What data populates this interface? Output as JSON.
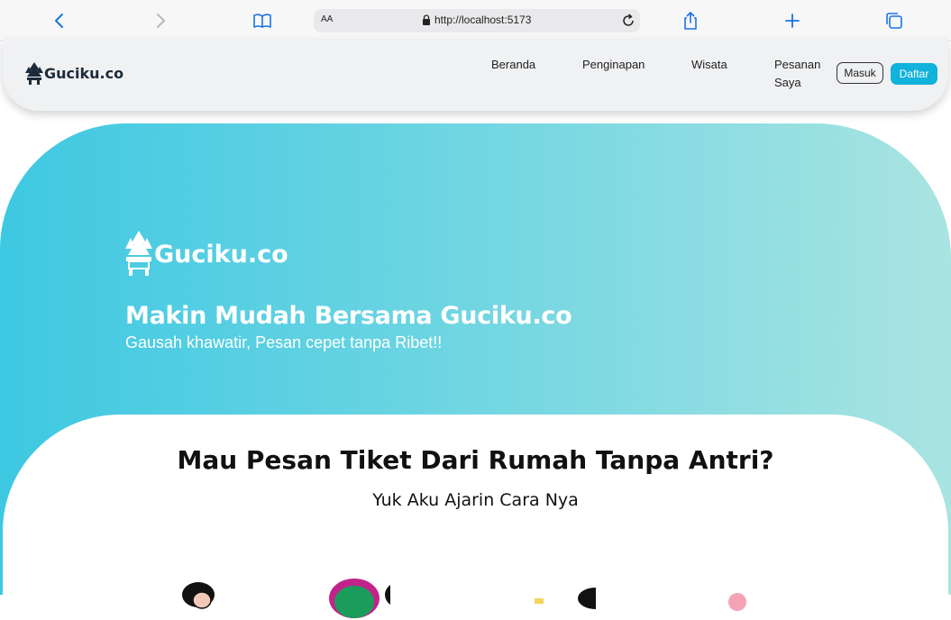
{
  "browser": {
    "text_size_label": "AA",
    "url": "http://localhost:5173"
  },
  "navbar": {
    "brand": "Guciku.co",
    "links": [
      "Beranda",
      "Penginapan",
      "Wisata",
      "Pesanan Saya"
    ],
    "login_label": "Masuk",
    "register_label": "Daftar"
  },
  "hero": {
    "brand": "Guciku.co",
    "title": "Makin Mudah Bersama Guciku.co",
    "subtitle": "Gausah khawatir, Pesan cepet tanpa Ribet!!"
  },
  "section": {
    "title": "Mau Pesan Tiket Dari Rumah Tanpa Antri?",
    "subtitle": "Yuk Aku Ajarin Cara Nya"
  },
  "colors": {
    "accent": "#11b2dc",
    "hero_start": "#3ec8e2",
    "hero_end": "#a9e4e1"
  }
}
